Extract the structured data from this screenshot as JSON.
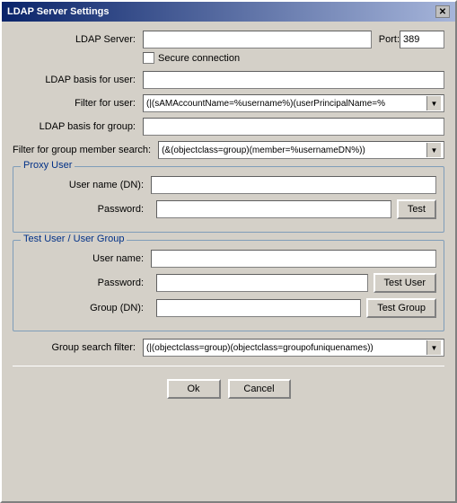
{
  "window": {
    "title": "LDAP Server Settings",
    "close_btn": "✕"
  },
  "form": {
    "ldap_server_label": "LDAP Server:",
    "ldap_server_value": "",
    "port_label": "Port:",
    "port_value": "389",
    "secure_label": "Secure connection",
    "ldap_basis_user_label": "LDAP basis for user:",
    "ldap_basis_user_value": "",
    "filter_user_label": "Filter for user:",
    "filter_user_value": "(|(sAMAccountName=%username%)(userPrincipalName=%",
    "ldap_basis_group_label": "LDAP basis for group:",
    "ldap_basis_group_value": "",
    "filter_group_label": "Filter for group member search:",
    "filter_group_value": "(&(objectclass=group)(member=%usernameDN%))"
  },
  "proxy_user": {
    "section_label": "Proxy User",
    "username_label": "User name (DN):",
    "username_value": "",
    "password_label": "Password:",
    "password_value": "",
    "test_btn": "Test"
  },
  "test_section": {
    "section_label": "Test User / User Group",
    "username_label": "User name:",
    "username_value": "",
    "password_label": "Password:",
    "password_value": "",
    "test_user_btn": "Test User",
    "group_label": "Group (DN):",
    "group_value": "",
    "test_group_btn": "Test Group"
  },
  "bottom": {
    "group_search_label": "Group search filter:",
    "group_search_value": "(|(objectclass=group)(objectclass=groupofuniquenames))",
    "ok_btn": "Ok",
    "cancel_btn": "Cancel"
  }
}
